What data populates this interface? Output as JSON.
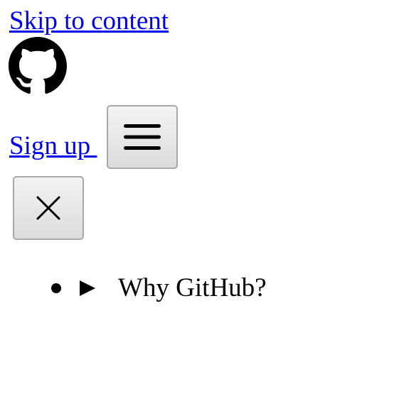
{
  "header": {
    "skip_link": "Skip to content",
    "logo_icon": "github-mark-icon",
    "signup_label": "Sign up ",
    "menu_icon": "hamburger-menu-icon",
    "close_icon": "close-icon"
  },
  "nav": {
    "items": [
      {
        "label": "Why GitHub?",
        "icon": "disclosure-triangle-icon"
      }
    ]
  },
  "colors": {
    "link": "#0000ee",
    "button_border": "#a9a9a9",
    "text": "#000000"
  }
}
